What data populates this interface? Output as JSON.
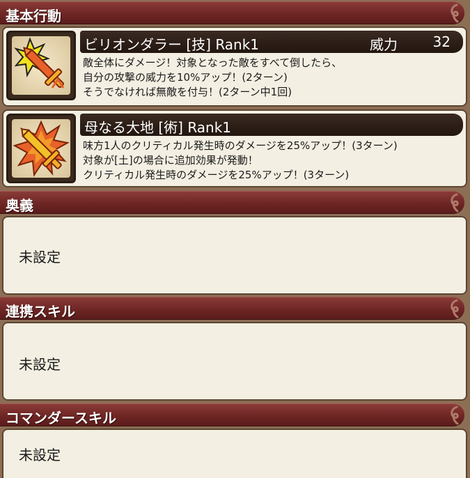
{
  "sections": {
    "basic_action": {
      "title": "基本行動"
    },
    "ougi": {
      "title": "奥義",
      "value": "未設定"
    },
    "link_skill": {
      "title": "連携スキル",
      "value": "未設定"
    },
    "commander_skill": {
      "title": "コマンダースキル",
      "value": "未設定"
    }
  },
  "skills": [
    {
      "name": "ビリオンダラー [技]  Rank1",
      "power_label": "威力",
      "power_value": "32",
      "icon": "shuriken-sword-icon",
      "description": [
        "敵全体にダメージ！対象となった敵をすべて倒したら、",
        "自分の攻撃の威力を10%アップ！(2ターン)",
        "そうでなければ無敵を付与！(2ターン中1回)"
      ]
    },
    {
      "name": "母なる大地 [術]  Rank1",
      "icon": "burst-sword-icon",
      "description": [
        "味方1人のクリティカル発生時のダメージを25%アップ！(3ターン)",
        "対象が[土]の場合に追加効果が発動！",
        "クリティカル発生時のダメージを25%アップ！(3ターン)"
      ]
    }
  ],
  "colors": {
    "header_red": "#6e2624",
    "panel_bg": "#f3efe2",
    "name_bar": "#22160f",
    "background": "#8c6e55"
  }
}
